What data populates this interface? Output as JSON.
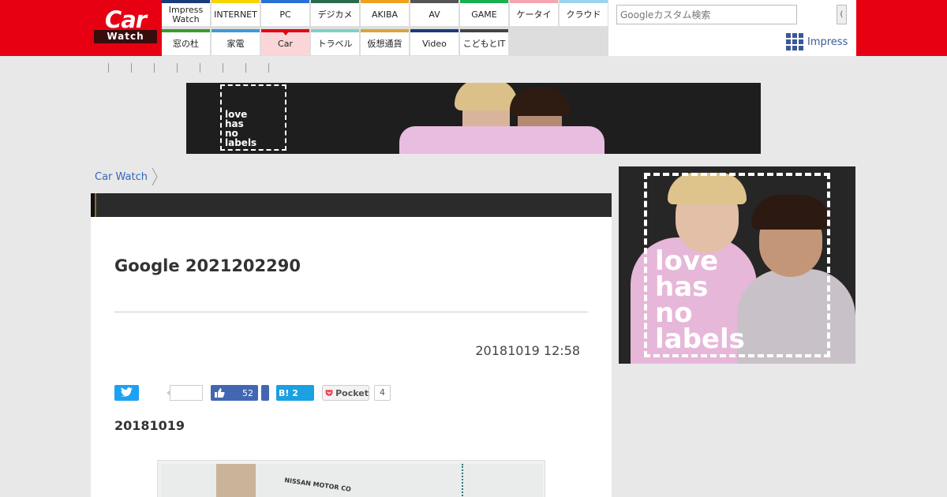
{
  "header": {
    "logo": {
      "car": "Car",
      "watch": "Watch"
    },
    "nav_row1": [
      {
        "label": "Impress\nWatch",
        "color": "#1a3a7a"
      },
      {
        "label": "INTERNET",
        "color": "#f5d400"
      },
      {
        "label": "PC",
        "color": "#2a6fd6"
      },
      {
        "label": "デジカメ",
        "color": "#2a6b4d"
      },
      {
        "label": "AKIBA",
        "color": "#f0a01e"
      },
      {
        "label": "AV",
        "color": "#555555"
      },
      {
        "label": "GAME",
        "color": "#18b050"
      },
      {
        "label": "ケータイ",
        "color": "#f6a5b0"
      },
      {
        "label": "クラウド",
        "color": "#9ad4ef"
      }
    ],
    "nav_row2": [
      {
        "label": "窓の杜",
        "color": "#3d9a2e"
      },
      {
        "label": "家電",
        "color": "#3d9ad4"
      },
      {
        "label": "Car",
        "color": "#e60012",
        "active": true
      },
      {
        "label": "トラベル",
        "color": "#7fd1c1"
      },
      {
        "label": "仮想通貨",
        "color": "#d9a53a"
      },
      {
        "label": "Video",
        "color": "#1a3a7a"
      },
      {
        "label": "こどもとIT",
        "color": "#444444"
      }
    ],
    "search": {
      "placeholder": "Googleカスタム検索",
      "button": "("
    },
    "impress_label": "Impress"
  },
  "banner": {
    "text": "love\nhas\nno\nlabels"
  },
  "side_ad": {
    "text": "love\nhas\nno\nlabels"
  },
  "breadcrumb": {
    "label": "Car Watch"
  },
  "article": {
    "title": "Google 2021202290",
    "date": "20181019 12:58",
    "subhead": "20181019",
    "share": {
      "facebook_count": "52",
      "hatena_label": "B! 2",
      "pocket_label": "Pocket",
      "pocket_count": "4"
    },
    "photo_caption": "NISSAN MOTOR CO"
  }
}
